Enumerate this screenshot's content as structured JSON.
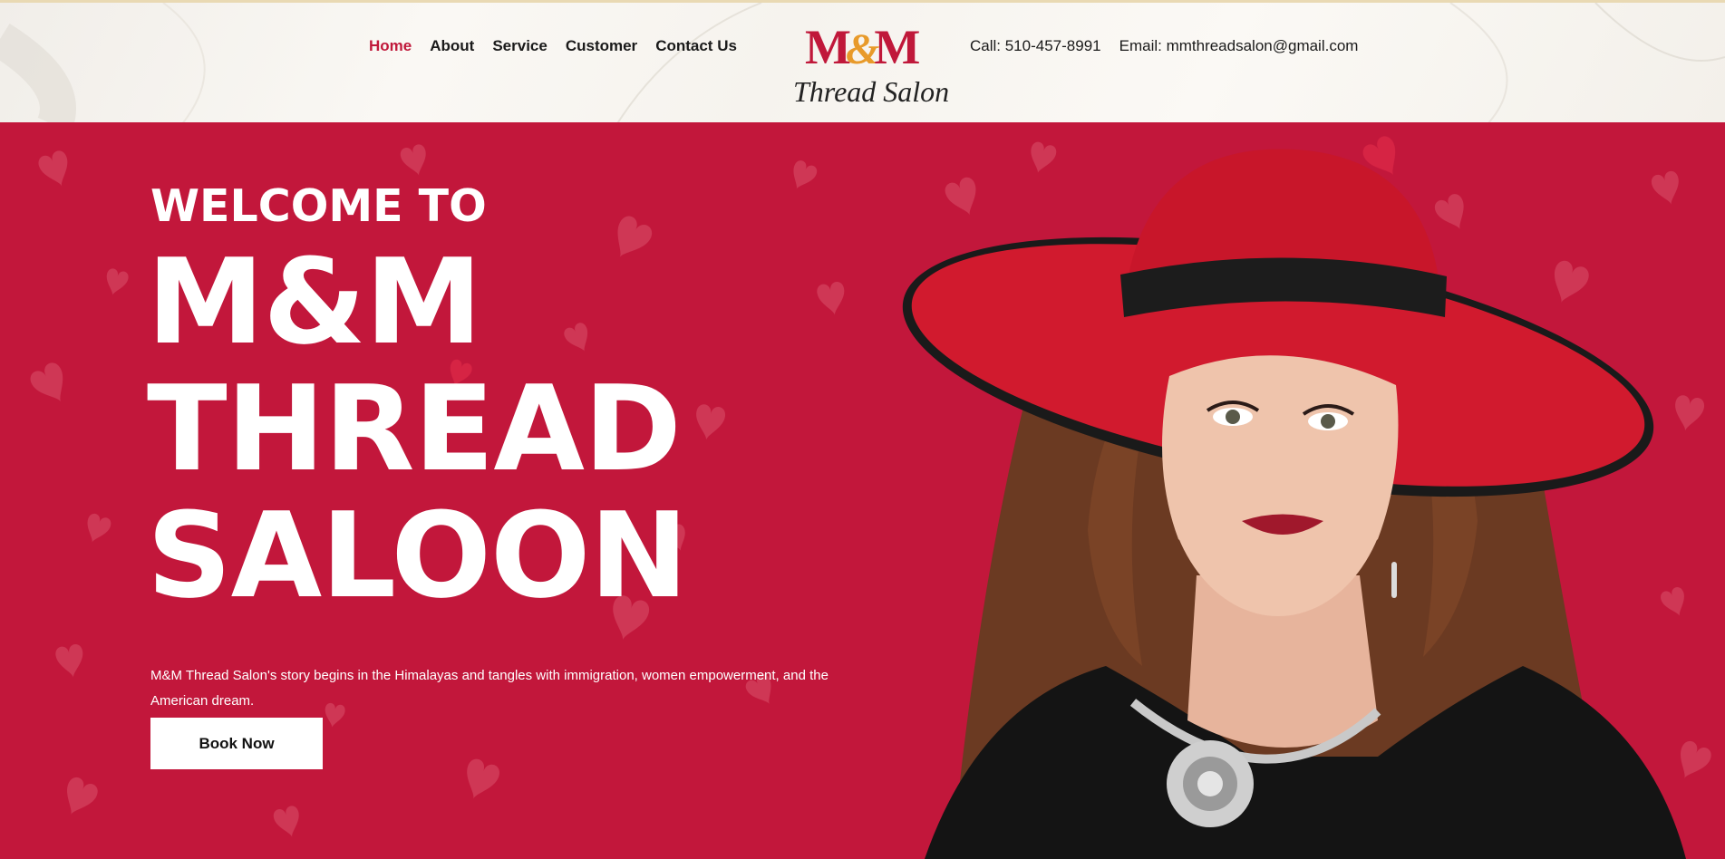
{
  "nav": {
    "items": [
      {
        "label": "Home",
        "active": true
      },
      {
        "label": "About",
        "active": false
      },
      {
        "label": "Service",
        "active": false
      },
      {
        "label": "Customer",
        "active": false
      },
      {
        "label": "Contact Us",
        "active": false
      }
    ]
  },
  "logo": {
    "main": "M&M",
    "sub": "Thread Salon"
  },
  "contact": {
    "phone": "Call: 510-457-8991",
    "email": "Email: mmthreadsalon@gmail.com"
  },
  "hero": {
    "welcome": "WELCOME TO",
    "title_line1": "M&M",
    "title_line2": "THREAD",
    "title_line3": "SALOON",
    "story": "M&M Thread Salon's story begins in the Himalayas and tangles with immigration, women empowerment, and the American dream.",
    "cta_label": "Book Now"
  },
  "colors": {
    "brand_red": "#c0183a",
    "hero_bg": "#c2173b",
    "accent_gold": "#e89a2a"
  }
}
